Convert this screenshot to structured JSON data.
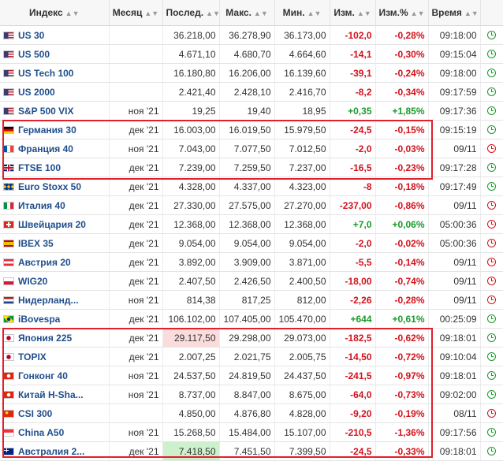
{
  "headers": {
    "index": "Индекс",
    "month": "Месяц",
    "last": "Послед.",
    "high": "Макс.",
    "low": "Мин.",
    "change": "Изм.",
    "change_pct": "Изм.%",
    "time": "Время"
  },
  "status_colors": {
    "negative": "#d3121c",
    "positive": "#1a9a2c",
    "highlight_box": "#e0212b"
  },
  "rows": [
    {
      "name": "US 30",
      "month": "",
      "last": "36.218,00",
      "high": "36.278,90",
      "low": "36.173,00",
      "chg": "-102,0",
      "pct": "-0,28%",
      "time": "09:18:00",
      "dir": "neg",
      "clock": "open",
      "flag": "us",
      "hl": ""
    },
    {
      "name": "US 500",
      "month": "",
      "last": "4.671,10",
      "high": "4.680,70",
      "low": "4.664,60",
      "chg": "-14,1",
      "pct": "-0,30%",
      "time": "09:15:04",
      "dir": "neg",
      "clock": "open",
      "flag": "us",
      "hl": ""
    },
    {
      "name": "US Tech 100",
      "month": "",
      "last": "16.180,80",
      "high": "16.206,00",
      "low": "16.139,60",
      "chg": "-39,1",
      "pct": "-0,24%",
      "time": "09:18:00",
      "dir": "neg",
      "clock": "open",
      "flag": "us",
      "hl": ""
    },
    {
      "name": "US 2000",
      "month": "",
      "last": "2.421,40",
      "high": "2.428,10",
      "low": "2.416,70",
      "chg": "-8,2",
      "pct": "-0,34%",
      "time": "09:17:59",
      "dir": "neg",
      "clock": "open",
      "flag": "us",
      "hl": ""
    },
    {
      "name": "S&P 500 VIX",
      "month": "ноя '21",
      "last": "19,25",
      "high": "19,40",
      "low": "18,95",
      "chg": "+0,35",
      "pct": "+1,85%",
      "time": "09:17:36",
      "dir": "pos",
      "clock": "open",
      "flag": "us",
      "hl": ""
    },
    {
      "name": "Германия 30",
      "month": "дек '21",
      "last": "16.003,00",
      "high": "16.019,50",
      "low": "15.979,50",
      "chg": "-24,5",
      "pct": "-0,15%",
      "time": "09:15:19",
      "dir": "neg",
      "clock": "open",
      "flag": "de",
      "hl": ""
    },
    {
      "name": "Франция 40",
      "month": "ноя '21",
      "last": "7.043,00",
      "high": "7.077,50",
      "low": "7.012,50",
      "chg": "-2,0",
      "pct": "-0,03%",
      "time": "09/11",
      "dir": "neg",
      "clock": "closed",
      "flag": "fr",
      "hl": ""
    },
    {
      "name": "FTSE 100",
      "month": "дек '21",
      "last": "7.239,00",
      "high": "7.259,50",
      "low": "7.237,00",
      "chg": "-16,5",
      "pct": "-0,23%",
      "time": "09:17:28",
      "dir": "neg",
      "clock": "open",
      "flag": "gb",
      "hl": ""
    },
    {
      "name": "Euro Stoxx 50",
      "month": "дек '21",
      "last": "4.328,00",
      "high": "4.337,00",
      "low": "4.323,00",
      "chg": "-8",
      "pct": "-0,18%",
      "time": "09:17:49",
      "dir": "neg",
      "clock": "open",
      "flag": "eu",
      "hl": ""
    },
    {
      "name": "Италия 40",
      "month": "дек '21",
      "last": "27.330,00",
      "high": "27.575,00",
      "low": "27.270,00",
      "chg": "-237,00",
      "pct": "-0,86%",
      "time": "09/11",
      "dir": "neg",
      "clock": "closed",
      "flag": "it",
      "hl": ""
    },
    {
      "name": "Швейцария 20",
      "month": "дек '21",
      "last": "12.368,00",
      "high": "12.368,00",
      "low": "12.368,00",
      "chg": "+7,0",
      "pct": "+0,06%",
      "time": "05:00:36",
      "dir": "pos",
      "clock": "closed",
      "flag": "ch",
      "hl": ""
    },
    {
      "name": "IBEX 35",
      "month": "дек '21",
      "last": "9.054,00",
      "high": "9.054,00",
      "low": "9.054,00",
      "chg": "-2,0",
      "pct": "-0,02%",
      "time": "05:00:36",
      "dir": "neg",
      "clock": "closed",
      "flag": "es",
      "hl": ""
    },
    {
      "name": "Австрия 20",
      "month": "дек '21",
      "last": "3.892,00",
      "high": "3.909,00",
      "low": "3.871,00",
      "chg": "-5,5",
      "pct": "-0,14%",
      "time": "09/11",
      "dir": "neg",
      "clock": "closed",
      "flag": "at",
      "hl": ""
    },
    {
      "name": "WIG20",
      "month": "дек '21",
      "last": "2.407,50",
      "high": "2.426,50",
      "low": "2.400,50",
      "chg": "-18,00",
      "pct": "-0,74%",
      "time": "09/11",
      "dir": "neg",
      "clock": "closed",
      "flag": "pl",
      "hl": ""
    },
    {
      "name": "Нидерланд...",
      "month": "ноя '21",
      "last": "814,38",
      "high": "817,25",
      "low": "812,00",
      "chg": "-2,26",
      "pct": "-0,28%",
      "time": "09/11",
      "dir": "neg",
      "clock": "closed",
      "flag": "nl",
      "hl": ""
    },
    {
      "name": "iBovespa",
      "month": "дек '21",
      "last": "106.102,00",
      "high": "107.405,00",
      "low": "105.470,00",
      "chg": "+644",
      "pct": "+0,61%",
      "time": "00:25:09",
      "dir": "pos",
      "clock": "open",
      "flag": "br",
      "hl": ""
    },
    {
      "name": "Япония 225",
      "month": "дек '21",
      "last": "29.117,50",
      "high": "29.298,00",
      "low": "29.073,00",
      "chg": "-182,5",
      "pct": "-0,62%",
      "time": "09:18:01",
      "dir": "neg",
      "clock": "open",
      "flag": "jp",
      "hl": "red"
    },
    {
      "name": "TOPIX",
      "month": "дек '21",
      "last": "2.007,25",
      "high": "2.021,75",
      "low": "2.005,75",
      "chg": "-14,50",
      "pct": "-0,72%",
      "time": "09:10:04",
      "dir": "neg",
      "clock": "open",
      "flag": "jp",
      "hl": ""
    },
    {
      "name": "Гонконг 40",
      "month": "ноя '21",
      "last": "24.537,50",
      "high": "24.819,50",
      "low": "24.437,50",
      "chg": "-241,5",
      "pct": "-0,97%",
      "time": "09:18:01",
      "dir": "neg",
      "clock": "open",
      "flag": "hk",
      "hl": ""
    },
    {
      "name": "Китай H-Sha...",
      "month": "ноя '21",
      "last": "8.737,00",
      "high": "8.847,00",
      "low": "8.675,00",
      "chg": "-64,0",
      "pct": "-0,73%",
      "time": "09:02:00",
      "dir": "neg",
      "clock": "open",
      "flag": "hk",
      "hl": ""
    },
    {
      "name": "CSI 300",
      "month": "",
      "last": "4.850,00",
      "high": "4.876,80",
      "low": "4.828,00",
      "chg": "-9,20",
      "pct": "-0,19%",
      "time": "08/11",
      "dir": "neg",
      "clock": "closed",
      "flag": "cn",
      "hl": ""
    },
    {
      "name": "China A50",
      "month": "ноя '21",
      "last": "15.268,50",
      "high": "15.484,00",
      "low": "15.107,00",
      "chg": "-210,5",
      "pct": "-1,36%",
      "time": "09:17:56",
      "dir": "neg",
      "clock": "open",
      "flag": "sg",
      "hl": ""
    },
    {
      "name": "Австралия 2...",
      "month": "дек '21",
      "last": "7.418,50",
      "high": "7.451,50",
      "low": "7.399,50",
      "chg": "-24,5",
      "pct": "-0,33%",
      "time": "09:18:01",
      "dir": "neg",
      "clock": "open",
      "flag": "au",
      "hl": "green"
    }
  ]
}
